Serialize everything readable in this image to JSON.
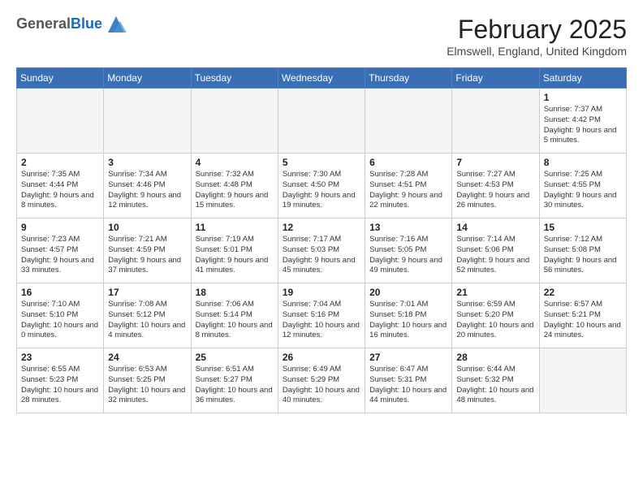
{
  "header": {
    "logo_general": "General",
    "logo_blue": "Blue",
    "month_title": "February 2025",
    "location": "Elmswell, England, United Kingdom"
  },
  "days_of_week": [
    "Sunday",
    "Monday",
    "Tuesday",
    "Wednesday",
    "Thursday",
    "Friday",
    "Saturday"
  ],
  "weeks": [
    [
      {
        "day": "",
        "info": ""
      },
      {
        "day": "",
        "info": ""
      },
      {
        "day": "",
        "info": ""
      },
      {
        "day": "",
        "info": ""
      },
      {
        "day": "",
        "info": ""
      },
      {
        "day": "",
        "info": ""
      },
      {
        "day": "1",
        "info": "Sunrise: 7:37 AM\nSunset: 4:42 PM\nDaylight: 9 hours and 5 minutes."
      }
    ],
    [
      {
        "day": "2",
        "info": "Sunrise: 7:35 AM\nSunset: 4:44 PM\nDaylight: 9 hours and 8 minutes."
      },
      {
        "day": "3",
        "info": "Sunrise: 7:34 AM\nSunset: 4:46 PM\nDaylight: 9 hours and 12 minutes."
      },
      {
        "day": "4",
        "info": "Sunrise: 7:32 AM\nSunset: 4:48 PM\nDaylight: 9 hours and 15 minutes."
      },
      {
        "day": "5",
        "info": "Sunrise: 7:30 AM\nSunset: 4:50 PM\nDaylight: 9 hours and 19 minutes."
      },
      {
        "day": "6",
        "info": "Sunrise: 7:28 AM\nSunset: 4:51 PM\nDaylight: 9 hours and 22 minutes."
      },
      {
        "day": "7",
        "info": "Sunrise: 7:27 AM\nSunset: 4:53 PM\nDaylight: 9 hours and 26 minutes."
      },
      {
        "day": "8",
        "info": "Sunrise: 7:25 AM\nSunset: 4:55 PM\nDaylight: 9 hours and 30 minutes."
      }
    ],
    [
      {
        "day": "9",
        "info": "Sunrise: 7:23 AM\nSunset: 4:57 PM\nDaylight: 9 hours and 33 minutes."
      },
      {
        "day": "10",
        "info": "Sunrise: 7:21 AM\nSunset: 4:59 PM\nDaylight: 9 hours and 37 minutes."
      },
      {
        "day": "11",
        "info": "Sunrise: 7:19 AM\nSunset: 5:01 PM\nDaylight: 9 hours and 41 minutes."
      },
      {
        "day": "12",
        "info": "Sunrise: 7:17 AM\nSunset: 5:03 PM\nDaylight: 9 hours and 45 minutes."
      },
      {
        "day": "13",
        "info": "Sunrise: 7:16 AM\nSunset: 5:05 PM\nDaylight: 9 hours and 49 minutes."
      },
      {
        "day": "14",
        "info": "Sunrise: 7:14 AM\nSunset: 5:06 PM\nDaylight: 9 hours and 52 minutes."
      },
      {
        "day": "15",
        "info": "Sunrise: 7:12 AM\nSunset: 5:08 PM\nDaylight: 9 hours and 56 minutes."
      }
    ],
    [
      {
        "day": "16",
        "info": "Sunrise: 7:10 AM\nSunset: 5:10 PM\nDaylight: 10 hours and 0 minutes."
      },
      {
        "day": "17",
        "info": "Sunrise: 7:08 AM\nSunset: 5:12 PM\nDaylight: 10 hours and 4 minutes."
      },
      {
        "day": "18",
        "info": "Sunrise: 7:06 AM\nSunset: 5:14 PM\nDaylight: 10 hours and 8 minutes."
      },
      {
        "day": "19",
        "info": "Sunrise: 7:04 AM\nSunset: 5:16 PM\nDaylight: 10 hours and 12 minutes."
      },
      {
        "day": "20",
        "info": "Sunrise: 7:01 AM\nSunset: 5:18 PM\nDaylight: 10 hours and 16 minutes."
      },
      {
        "day": "21",
        "info": "Sunrise: 6:59 AM\nSunset: 5:20 PM\nDaylight: 10 hours and 20 minutes."
      },
      {
        "day": "22",
        "info": "Sunrise: 6:57 AM\nSunset: 5:21 PM\nDaylight: 10 hours and 24 minutes."
      }
    ],
    [
      {
        "day": "23",
        "info": "Sunrise: 6:55 AM\nSunset: 5:23 PM\nDaylight: 10 hours and 28 minutes."
      },
      {
        "day": "24",
        "info": "Sunrise: 6:53 AM\nSunset: 5:25 PM\nDaylight: 10 hours and 32 minutes."
      },
      {
        "day": "25",
        "info": "Sunrise: 6:51 AM\nSunset: 5:27 PM\nDaylight: 10 hours and 36 minutes."
      },
      {
        "day": "26",
        "info": "Sunrise: 6:49 AM\nSunset: 5:29 PM\nDaylight: 10 hours and 40 minutes."
      },
      {
        "day": "27",
        "info": "Sunrise: 6:47 AM\nSunset: 5:31 PM\nDaylight: 10 hours and 44 minutes."
      },
      {
        "day": "28",
        "info": "Sunrise: 6:44 AM\nSunset: 5:32 PM\nDaylight: 10 hours and 48 minutes."
      },
      {
        "day": "",
        "info": ""
      }
    ]
  ]
}
